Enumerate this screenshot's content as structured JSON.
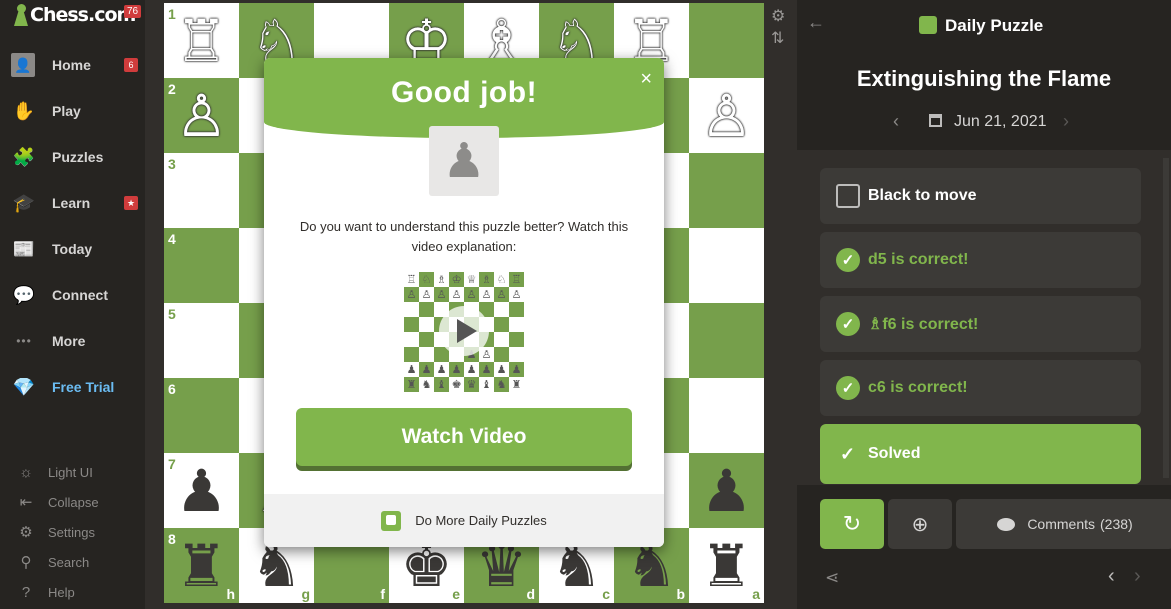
{
  "sidebar": {
    "logo_text": "Chess.com",
    "logo_badge": "76",
    "items": [
      {
        "label": "Home",
        "icon": "home-icon",
        "glyph": "👤",
        "badge": "6"
      },
      {
        "label": "Play",
        "icon": "play-icon",
        "glyph": "✋",
        "badge": ""
      },
      {
        "label": "Puzzles",
        "icon": "puzzles-icon",
        "glyph": "🧩",
        "badge": ""
      },
      {
        "label": "Learn",
        "icon": "learn-icon",
        "glyph": "🎓",
        "badge": "★"
      },
      {
        "label": "Today",
        "icon": "today-icon",
        "glyph": "📰",
        "badge": ""
      },
      {
        "label": "Connect",
        "icon": "connect-icon",
        "glyph": "💬",
        "badge": ""
      },
      {
        "label": "More",
        "icon": "more-icon",
        "glyph": "•••",
        "badge": ""
      },
      {
        "label": "Free Trial",
        "icon": "diamond-icon",
        "glyph": "💎",
        "badge": ""
      }
    ],
    "utilities": [
      {
        "label": "Light UI",
        "glyph": "☼"
      },
      {
        "label": "Collapse",
        "glyph": "⇤"
      },
      {
        "label": "Settings",
        "glyph": "⚙"
      },
      {
        "label": "Search",
        "glyph": "⚲"
      },
      {
        "label": "Help",
        "glyph": "?"
      }
    ]
  },
  "board": {
    "ranks": [
      "1",
      "2",
      "3",
      "4",
      "5",
      "6",
      "7",
      "8"
    ],
    "files": [
      "h",
      "g",
      "f",
      "e",
      "d",
      "c",
      "b",
      "a"
    ],
    "pieces": [
      [
        "♖",
        "♘",
        "",
        "♔",
        "♗",
        "♘",
        "♖",
        ""
      ],
      [
        "♙",
        "",
        "",
        "",
        "",
        "",
        "",
        "♙"
      ],
      [
        "",
        "",
        "",
        "",
        "",
        "",
        "",
        ""
      ],
      [
        "",
        "",
        "",
        "",
        "",
        "",
        "",
        ""
      ],
      [
        "",
        "",
        "",
        "",
        "",
        "",
        "",
        ""
      ],
      [
        "",
        "",
        "",
        "",
        "",
        "",
        "",
        ""
      ],
      [
        "♟",
        "♗",
        "",
        "",
        "",
        "",
        "",
        "♟"
      ],
      [
        "♜",
        "♞",
        "",
        "♚",
        "♛",
        "♞",
        "♞",
        "♜"
      ]
    ],
    "colors": {
      "light": "#ffffff",
      "dark": "#769f4b"
    }
  },
  "modal": {
    "title": "Good job!",
    "close": "×",
    "avatar": "♟",
    "message": "Do you want to understand this puzzle better? Watch this video explanation:",
    "watch_label": "Watch Video",
    "footer_label": "Do More Daily Puzzles"
  },
  "panel": {
    "title": "Daily Puzzle",
    "back": "←",
    "puzzle_name": "Extinguishing the Flame",
    "date": "Jun 21, 2021",
    "prev": "‹",
    "next": "›",
    "prompt": "Black to move",
    "moves": [
      "d5 is correct!",
      "♗f6 is correct!",
      "c6 is correct!"
    ],
    "solved_label": "Solved",
    "comments_label": "Comments",
    "comments_count": "(238)",
    "accent": "#81b64c"
  }
}
